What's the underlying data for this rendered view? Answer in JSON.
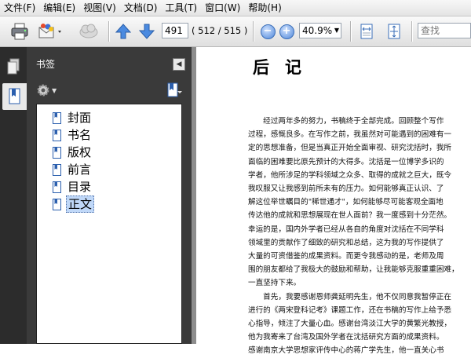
{
  "menu": [
    "文件(F)",
    "编辑(E)",
    "视图(V)",
    "文档(D)",
    "工具(T)",
    "窗口(W)",
    "帮助(H)"
  ],
  "toolbar": {
    "page_current": "491",
    "page_of": "( 512 / 515 )",
    "zoom": "40.9%",
    "search_placeholder": "查找"
  },
  "panel": {
    "title": "书签",
    "bookmarks": [
      "封面",
      "书名",
      "版权",
      "前言",
      "目录",
      "正文"
    ],
    "selected_index": 5
  },
  "document": {
    "title": "后记",
    "lines": [
      "　　经过两年多的努力，书稿终于全部完成。回顾整个写作",
      "过程，感慨良多。在写作之前，我虽然对可能遇到的困难有一",
      "定的思想准备，但是当真正开始全面审视、研究沈括时，我所",
      "面临的困难要比原先预计的大得多。沈括是一位博学多识的",
      "学者，他所涉足的学科领域之众多、取得的成就之巨大，既令",
      "我叹服又让我感到前所未有的压力。如何能够真正认识、了",
      "解这位举世瞩目的\"稀世通才\"，如何能够尽可能客观全面地",
      "传达他的成就和思想展现在世人面前？我一度感到十分茫然。",
      "幸运的是，国内外学者已经从各自的角度对沈括在不同学科",
      "领域里的贡献作了细致的研究和总结，这为我的写作提供了",
      "大量的可资借鉴的成果资料。而更令我感动的是，老师及周",
      "围的朋友都给了我极大的鼓励和帮助，让我能够克服重重困难，",
      "一直坚持下来。",
      "　　首先，我要感谢恩师龚延明先生，他不仅同意我暂停正在",
      "进行的《两宋登科记考》课题工作，还在书稿的写作上给予悉",
      "心指导，倾注了大量心血。感谢台湾淡江大学的黄繁光教授，",
      "他为我寄来了台湾及国外学者在沈括研究方面的成果资料。",
      "感谢南京大学思想家评传中心的蒋广学先生，他一直关心书"
    ]
  }
}
